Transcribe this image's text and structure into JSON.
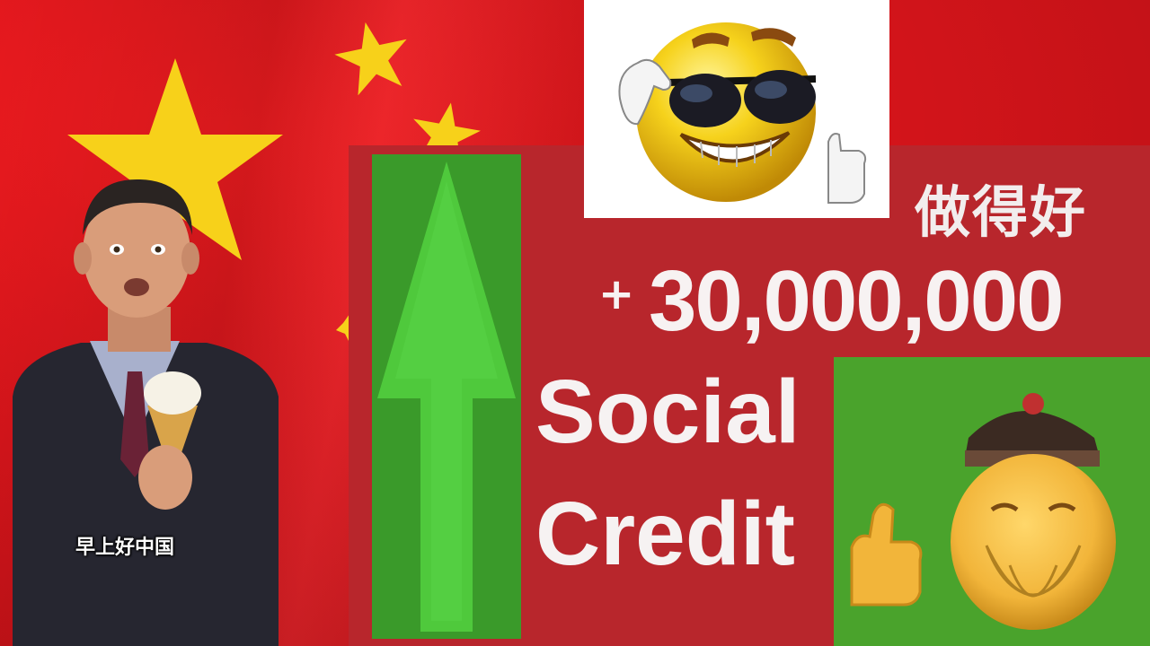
{
  "background": {
    "flag_red": "#d7151b",
    "star_yellow": "#f7d11a"
  },
  "credit": {
    "title_cn": "做得好",
    "plus_sign": "+",
    "amount": "30,000,000",
    "line1": "Social",
    "line2": "Credit",
    "arrow_color": "#4fc93c",
    "panel_color": "#b8262c"
  },
  "images": {
    "smiley_icon": "cool-smiley-sunglasses-thumbs-up-icon",
    "emoji_icon": "chinese-elder-emoji-thumbs-up-icon",
    "man_icon": "man-holding-ice-cream-cone"
  },
  "man": {
    "caption": "早上好中国"
  }
}
